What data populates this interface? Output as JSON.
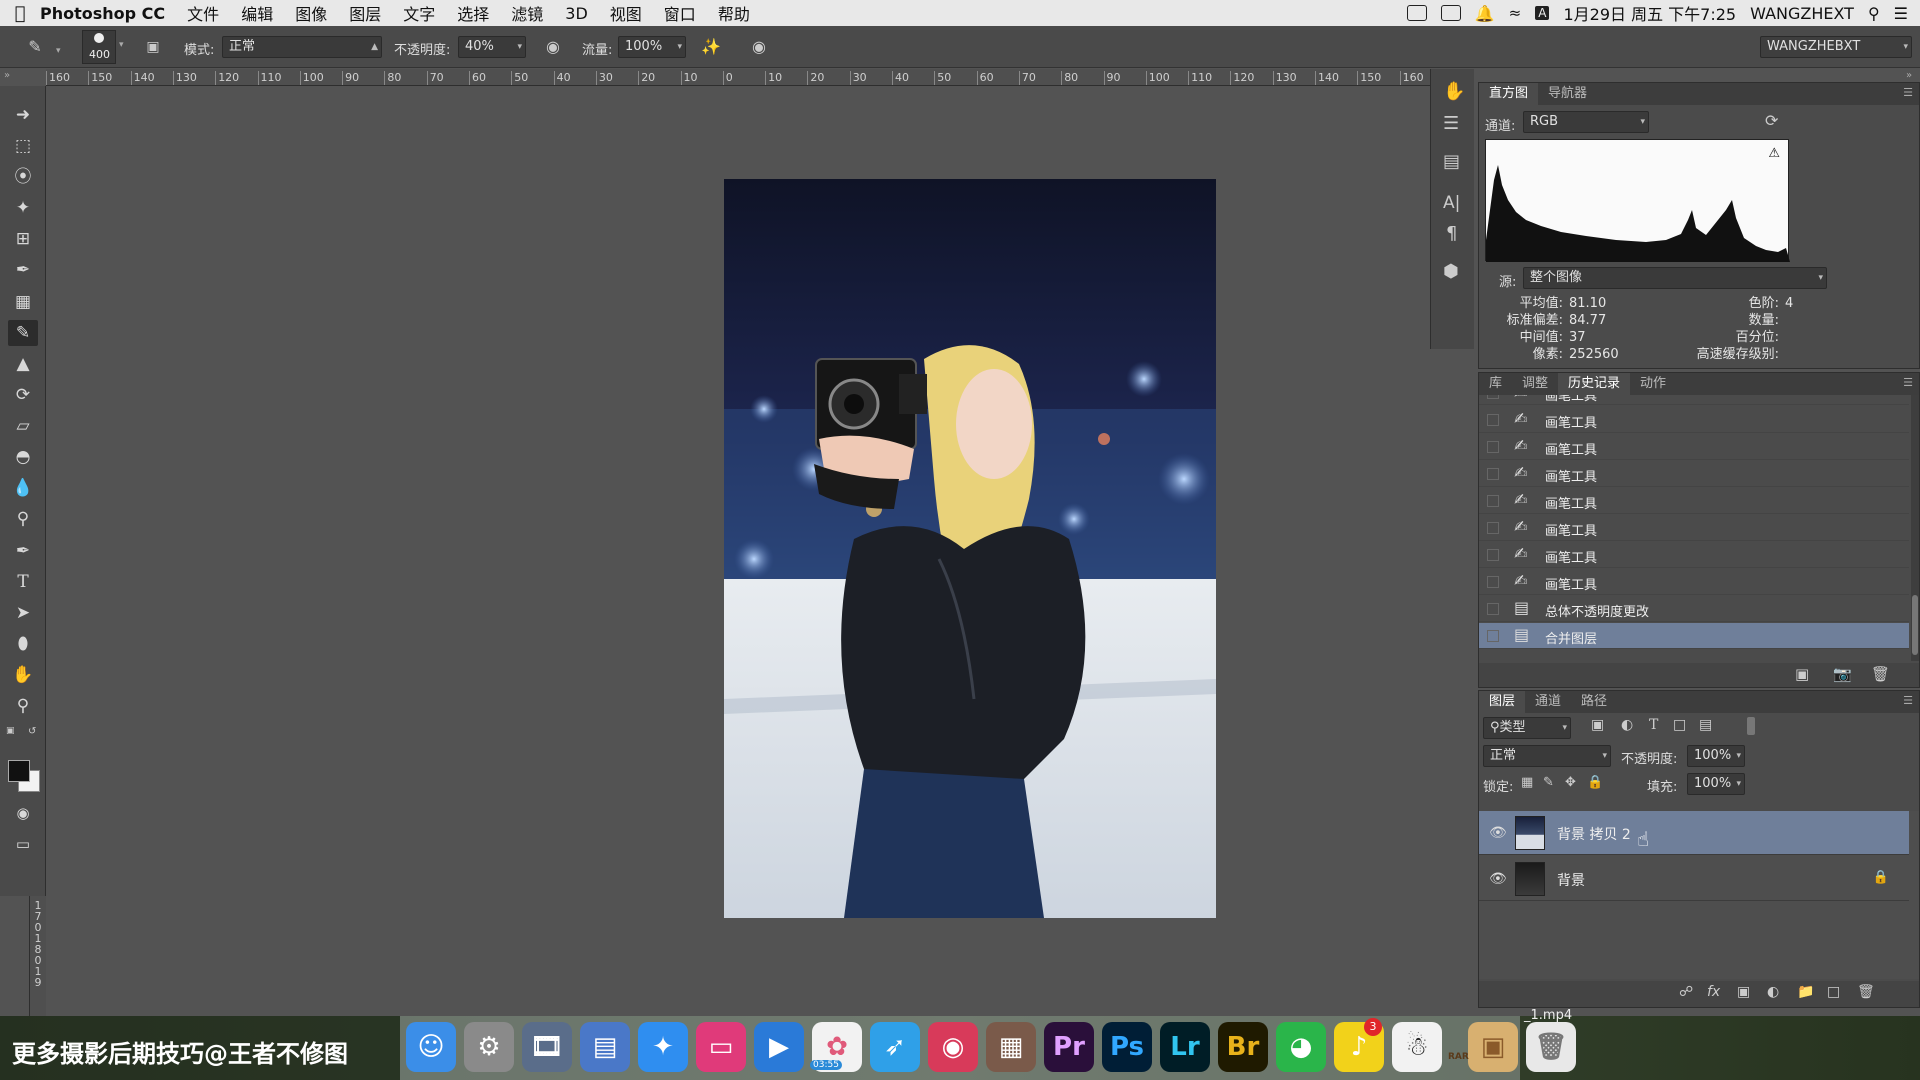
{
  "menubar": {
    "apple": "",
    "app_name": "Photoshop CC",
    "items": [
      "文件",
      "编辑",
      "图像",
      "图层",
      "文字",
      "选择",
      "滤镜",
      "3D",
      "视图",
      "窗口",
      "帮助"
    ],
    "input_method": "A",
    "datetime": "1月29日 周五 下午7:25",
    "user": "WANGZHEXT"
  },
  "options": {
    "brush_size": "400",
    "mode_label": "模式:",
    "mode_value": "正常",
    "opacity_label": "不透明度:",
    "opacity_value": "40%",
    "flow_label": "流量:",
    "flow_value": "100%",
    "workspace": "WANGZHEBXT"
  },
  "ruler": {
    "ticks": [
      "160",
      "150",
      "140",
      "130",
      "120",
      "110",
      "100",
      "90",
      "80",
      "70",
      "60",
      "50",
      "40",
      "30",
      "20",
      "10",
      "0",
      "10",
      "20",
      "30",
      "40",
      "50",
      "60",
      "70",
      "80",
      "90",
      "100",
      "110",
      "120",
      "130",
      "140",
      "150",
      "160"
    ],
    "vticks": [
      "1",
      "7",
      "0",
      "1",
      "8",
      "0",
      "1",
      "9"
    ]
  },
  "histogram_panel": {
    "tabs": [
      "直方图",
      "导航器"
    ],
    "channel_label": "通道:",
    "channel_value": "RGB",
    "source_label": "源:",
    "source_value": "整个图像",
    "stats_left": [
      {
        "label": "平均值:",
        "value": "81.10"
      },
      {
        "label": "标准偏差:",
        "value": "84.77"
      },
      {
        "label": "中间值:",
        "value": "37"
      },
      {
        "label": "像素:",
        "value": "252560"
      }
    ],
    "stats_right": [
      {
        "label": "色阶:",
        "value": ""
      },
      {
        "label": "数量:",
        "value": ""
      },
      {
        "label": "百分位:",
        "value": ""
      },
      {
        "label": "高速缓存级别:",
        "value": "4"
      }
    ]
  },
  "history_panel": {
    "tabs": [
      "库",
      "调整",
      "历史记录",
      "动作"
    ],
    "items": [
      "画笔工具",
      "画笔工具",
      "画笔工具",
      "画笔工具",
      "画笔工具",
      "画笔工具",
      "画笔工具",
      "画笔工具",
      "总体不透明度更改",
      "合并图层"
    ]
  },
  "layers_panel": {
    "tabs": [
      "图层",
      "通道",
      "路径"
    ],
    "filter_value": "类型",
    "blend_value": "正常",
    "opacity_label": "不透明度:",
    "opacity_value": "100%",
    "lock_label": "锁定:",
    "fill_label": "填充:",
    "fill_value": "100%",
    "layers": [
      {
        "name": "背景 拷贝 2",
        "selected": true
      },
      {
        "name": "背景",
        "selected": false
      }
    ]
  },
  "overlay": {
    "watermark": "更多摄影后期技巧@王者不修图",
    "file_label": "_1.mp4"
  },
  "dock": {
    "apps": [
      {
        "name": "finder-icon",
        "text": "☺"
      },
      {
        "name": "system-preferences-icon",
        "text": "⚙"
      },
      {
        "name": "photo-slideshow-icon",
        "text": "🎞"
      },
      {
        "name": "image-capture-icon",
        "text": "▤"
      },
      {
        "name": "safari-icon",
        "text": "✦"
      },
      {
        "name": "mac-display-icon",
        "text": "▭"
      },
      {
        "name": "quicktime-icon",
        "text": "▶"
      },
      {
        "name": "photos-icon",
        "text": "✿"
      },
      {
        "name": "bird-app-icon",
        "text": "➶"
      },
      {
        "name": "cleaner-icon",
        "text": "◉"
      },
      {
        "name": "photo-booth-icon",
        "text": "▦"
      },
      {
        "name": "premiere-icon",
        "text": "Pr"
      },
      {
        "name": "photoshop-icon",
        "text": "Ps"
      },
      {
        "name": "lightroom-icon",
        "text": "Lr"
      },
      {
        "name": "bridge-icon",
        "text": "Br"
      },
      {
        "name": "wechat-icon",
        "text": "◕"
      },
      {
        "name": "music-icon",
        "text": "♪"
      },
      {
        "name": "qq-icon",
        "text": "☃"
      },
      {
        "name": "archive-icon",
        "text": "▣"
      },
      {
        "name": "trash-icon",
        "text": "🗑"
      }
    ],
    "qq_badge": "3",
    "bird_badge": "03:55",
    "archive_label": "RAR"
  }
}
